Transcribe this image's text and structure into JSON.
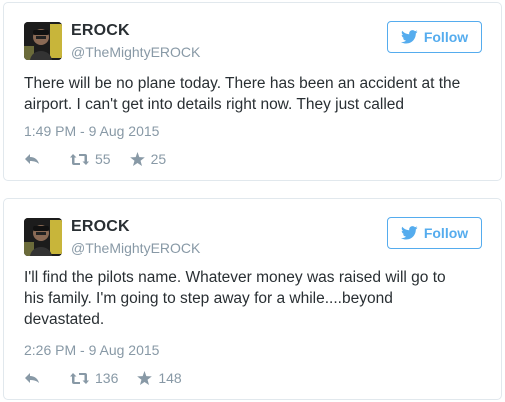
{
  "tweets": [
    {
      "display_name": "EROCK",
      "screen_name": "@TheMightyEROCK",
      "follow_label": "Follow",
      "text": "There will be no plane today. There has been an accident at the\nairport. I can't get into details right now. They just called",
      "timestamp": "1:49 PM - 9 Aug 2015",
      "retweets": "55",
      "favorites": "25"
    },
    {
      "display_name": "EROCK",
      "screen_name": "@TheMightyEROCK",
      "follow_label": "Follow",
      "text": "I'll find the pilots name. Whatever money was raised will go to\nhis family. I'm going to step away for a while....beyond\ndevastated.",
      "timestamp": "2:26 PM - 9 Aug 2015",
      "retweets": "136",
      "favorites": "148"
    }
  ],
  "icons": {
    "brand": "twitter-bird-icon",
    "reply": "reply-icon",
    "retweet": "retweet-icon",
    "favorite": "star-icon"
  },
  "colors": {
    "accent": "#55acee",
    "muted": "#8899a6",
    "text": "#292f33",
    "border": "#e1e8ed"
  }
}
